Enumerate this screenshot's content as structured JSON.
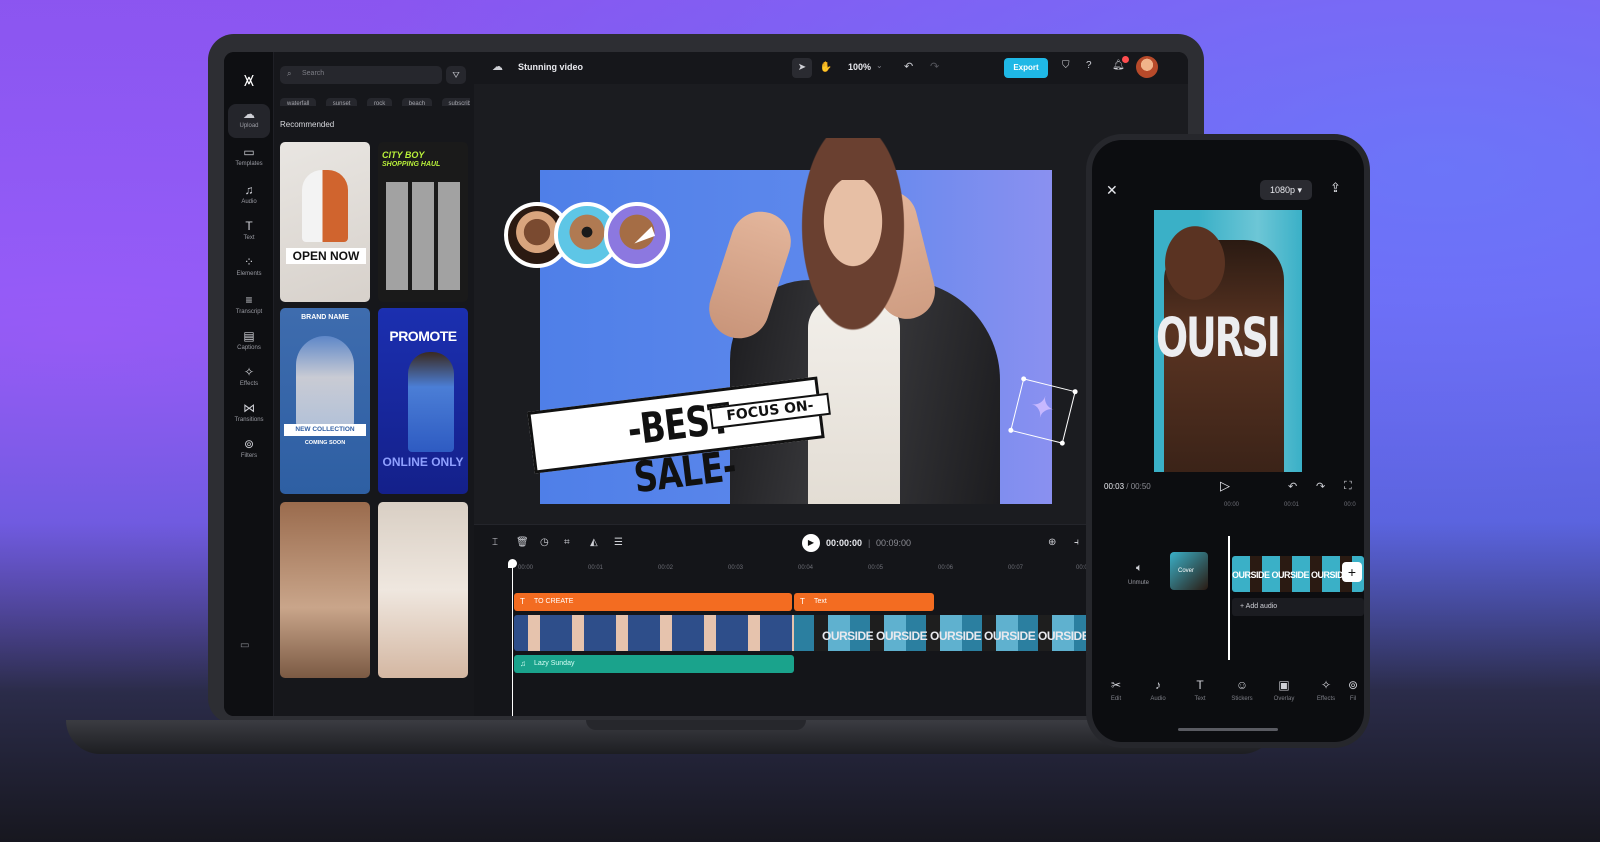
{
  "desktop": {
    "project_title": "Stunning video",
    "search_placeholder": "Search",
    "chips": [
      "waterfall",
      "sunset",
      "rock",
      "beach",
      "subscribe"
    ],
    "recommended_label": "Recommended",
    "rail": [
      {
        "label": "Upload",
        "icon": "upload-cloud-icon",
        "glyph": "☁"
      },
      {
        "label": "Templates",
        "icon": "templates-icon",
        "glyph": "▭"
      },
      {
        "label": "Audio",
        "icon": "music-note-icon",
        "glyph": "♫"
      },
      {
        "label": "Text",
        "icon": "text-icon",
        "glyph": "T"
      },
      {
        "label": "Elements",
        "icon": "elements-icon",
        "glyph": "⁘"
      },
      {
        "label": "Transcript",
        "icon": "transcript-icon",
        "glyph": "≡"
      },
      {
        "label": "Captions",
        "icon": "captions-icon",
        "glyph": "▤"
      },
      {
        "label": "Effects",
        "icon": "effects-icon",
        "glyph": "✧"
      },
      {
        "label": "Transitions",
        "icon": "transitions-icon",
        "glyph": "⋈"
      },
      {
        "label": "Filters",
        "icon": "filters-icon",
        "glyph": "⊚"
      }
    ],
    "templates": {
      "open_now": "OPEN NOW",
      "city_boy": "CITY BOY",
      "shopping_haul": "SHOPPING HAUL",
      "brand_name": "BRAND NAME",
      "new_collection": "NEW COLLECTION",
      "coming_soon": "COMING SOON",
      "promote": "PROMOTE",
      "online_only": "ONLINE ONLY"
    },
    "zoom": "100%",
    "export_label": "Export",
    "canvas": {
      "sale_text": "-BEST SALE-",
      "focus_text": "FOCUS ON-"
    },
    "timeline": {
      "current_time": "00:00:00",
      "separator": "|",
      "total_time": "00:09:00",
      "ticks": [
        "00:00",
        "00:01",
        "00:02",
        "00:03",
        "00:04",
        "00:05",
        "00:06",
        "00:07",
        "00:0"
      ],
      "text_clip_1": "TO CREATE",
      "text_clip_2": "Text",
      "video_overlay_text": "OURSIDE OURSIDE OURSIDE OURSIDE OURSIDE OURSIDE OURSIDE",
      "audio_clip": "Lazy Sunday"
    }
  },
  "mobile": {
    "resolution": "1080p ▾",
    "preview_word": "OURSI",
    "current_time": "00:03",
    "total_time": "/ 00:50",
    "ticks": [
      "00:00",
      "00:01",
      "00:0"
    ],
    "unmute_label": "Unmute",
    "cover_label": "Cover",
    "clip_text": "OURSIDE OURSIDE OURSIDE",
    "add_audio": "+ Add audio",
    "nav": [
      {
        "label": "Edit",
        "icon": "scissors-icon",
        "glyph": "✂"
      },
      {
        "label": "Audio",
        "icon": "music-note-icon",
        "glyph": "♪"
      },
      {
        "label": "Text",
        "icon": "text-icon",
        "glyph": "T"
      },
      {
        "label": "Stickers",
        "icon": "stickers-icon",
        "glyph": "☺"
      },
      {
        "label": "Overlay",
        "icon": "overlay-icon",
        "glyph": "▣"
      },
      {
        "label": "Effects",
        "icon": "effects-icon",
        "glyph": "✧"
      },
      {
        "label": "Fil",
        "icon": "filters-icon",
        "glyph": "⊚"
      }
    ]
  }
}
